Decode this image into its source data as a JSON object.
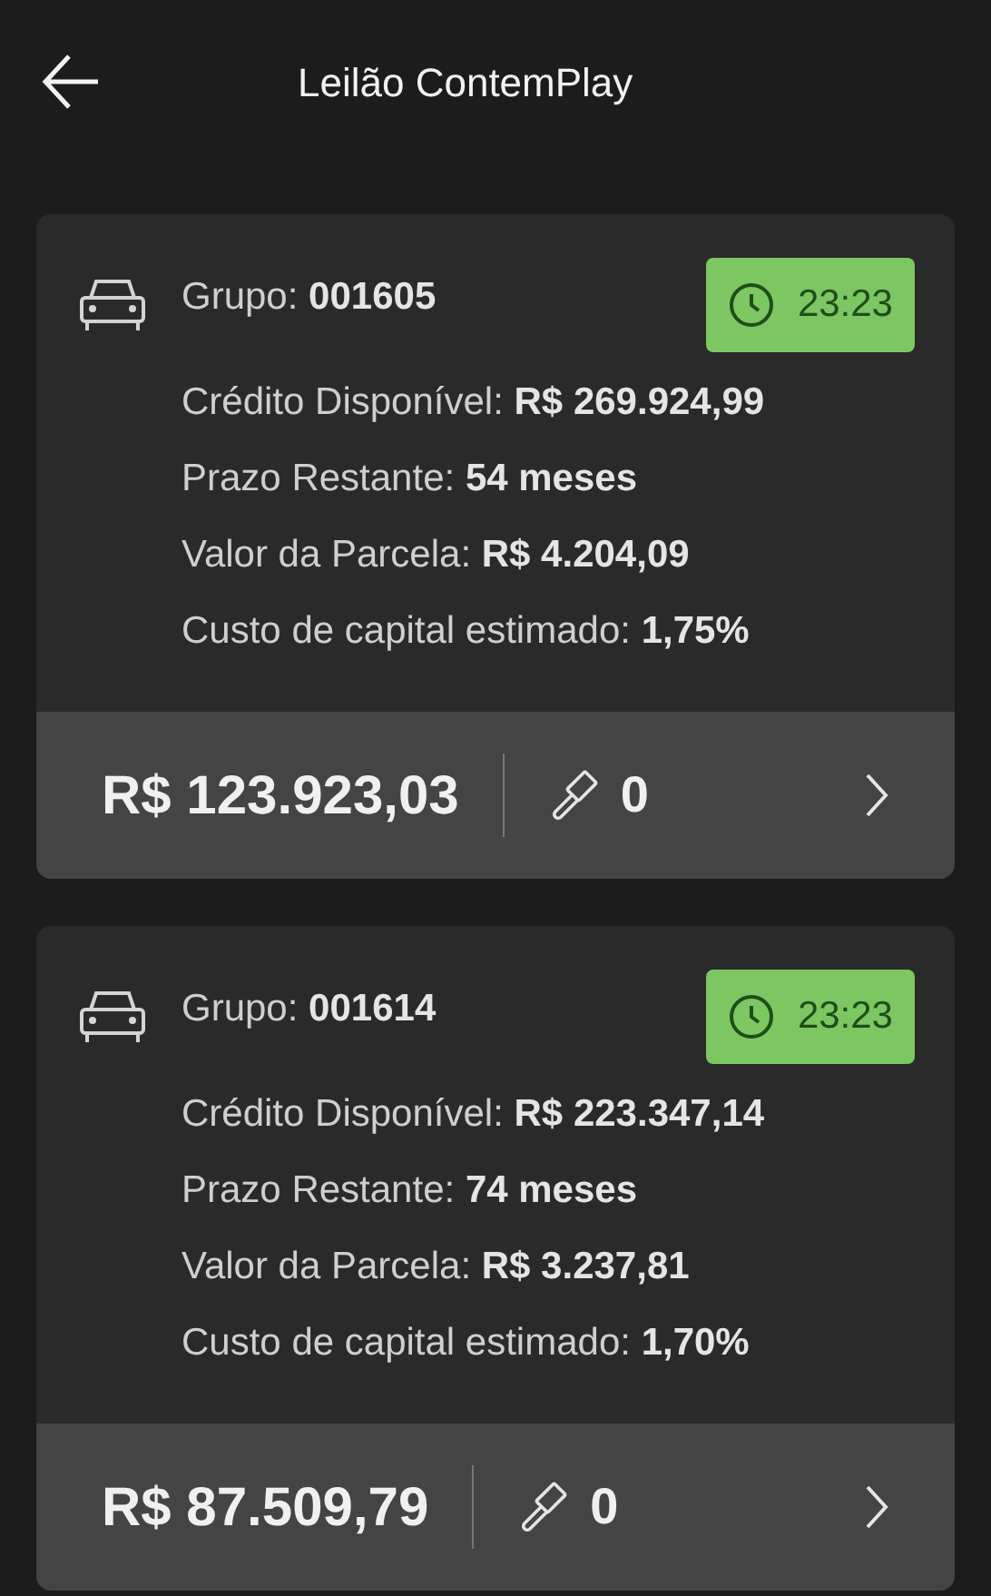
{
  "header": {
    "title": "Leilão ContemPlay"
  },
  "lots": [
    {
      "group_label": "Grupo:",
      "group": "001605",
      "timer": "23:23",
      "fields": [
        {
          "label": "Crédito Disponível:",
          "value": "R$ 269.924,99"
        },
        {
          "label": "Prazo Restante:",
          "value": "54 meses"
        },
        {
          "label": "Valor da Parcela:",
          "value": "R$ 4.204,09"
        },
        {
          "label": "Custo de capital estimado:",
          "value": "1,75%"
        }
      ],
      "price": "R$ 123.923,03",
      "bids": "0"
    },
    {
      "group_label": "Grupo:",
      "group": "001614",
      "timer": "23:23",
      "fields": [
        {
          "label": "Crédito Disponível:",
          "value": "R$ 223.347,14"
        },
        {
          "label": "Prazo Restante:",
          "value": "74 meses"
        },
        {
          "label": "Valor da Parcela:",
          "value": "R$ 3.237,81"
        },
        {
          "label": "Custo de capital estimado:",
          "value": "1,70%"
        }
      ],
      "price": "R$ 87.509,79",
      "bids": "0"
    }
  ]
}
